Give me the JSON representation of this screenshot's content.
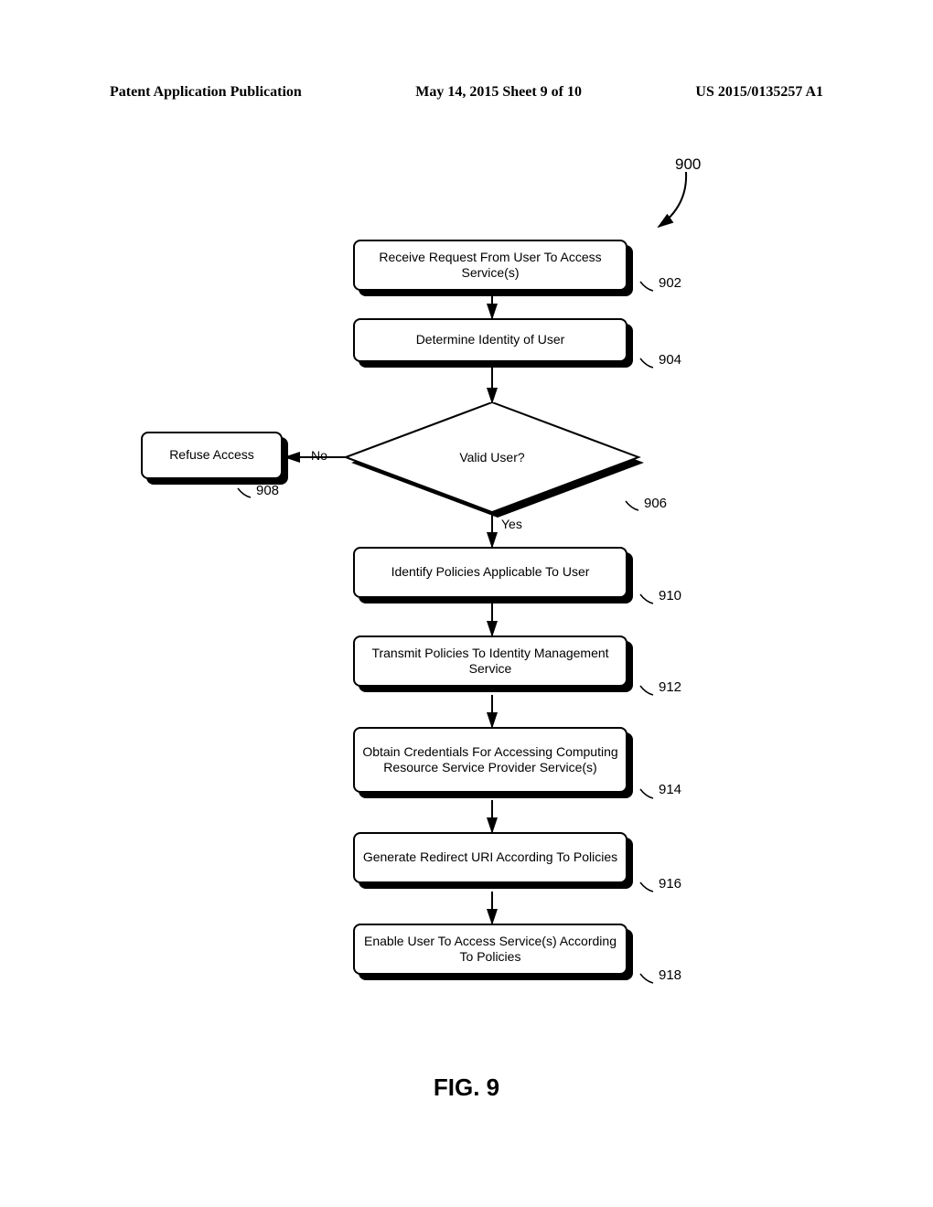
{
  "header": {
    "left": "Patent Application Publication",
    "center": "May 14, 2015  Sheet 9 of 10",
    "right": "US 2015/0135257 A1"
  },
  "flow": {
    "overall_ref": "900",
    "step1": {
      "text": "Receive Request From User To Access Service(s)",
      "ref": "902"
    },
    "step2": {
      "text": "Determine Identity of User",
      "ref": "904"
    },
    "decision": {
      "text": "Valid User?",
      "ref": "906",
      "yes_label": "Yes",
      "no_label": "No"
    },
    "refuse": {
      "text": "Refuse Access",
      "ref": "908"
    },
    "step3": {
      "text": "Identify Policies Applicable To User",
      "ref": "910"
    },
    "step4": {
      "text": "Transmit Policies To Identity Management Service",
      "ref": "912"
    },
    "step5": {
      "text": "Obtain Credentials For Accessing Computing Resource Service Provider Service(s)",
      "ref": "914"
    },
    "step6": {
      "text": "Generate Redirect URI According To Policies",
      "ref": "916"
    },
    "step7": {
      "text": "Enable User To Access Service(s) According To Policies",
      "ref": "918"
    }
  },
  "figure_label": "FIG. 9"
}
